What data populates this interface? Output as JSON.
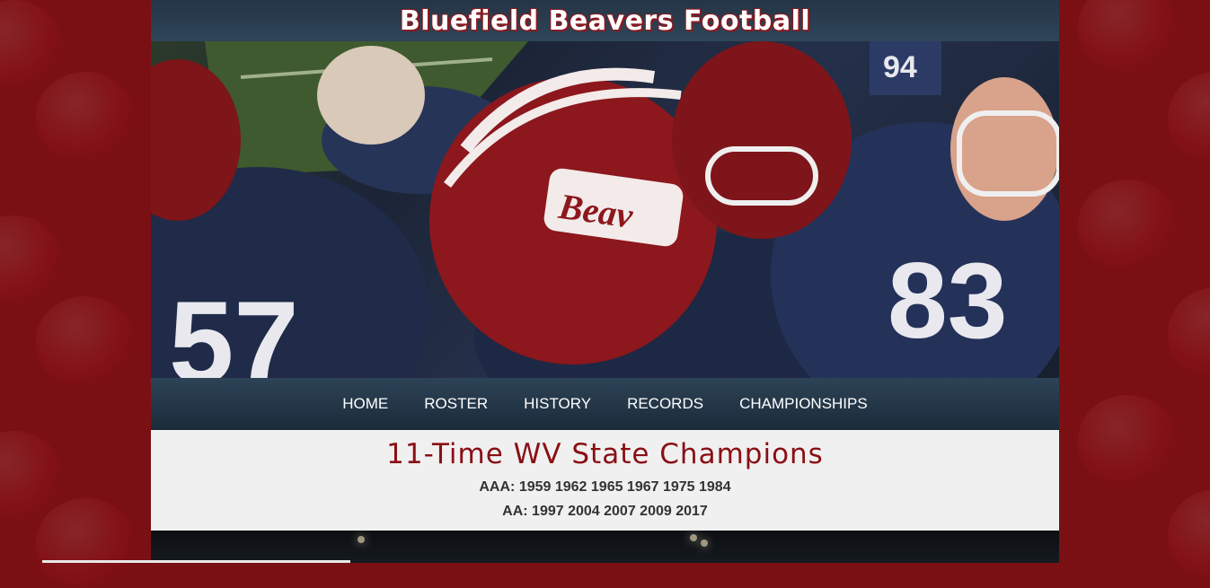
{
  "site": {
    "title": "Bluefield Beavers Football"
  },
  "nav": {
    "items": [
      {
        "label": "HOME"
      },
      {
        "label": "ROSTER"
      },
      {
        "label": "HISTORY"
      },
      {
        "label": "RECORDS"
      },
      {
        "label": "CHAMPIONSHIPS"
      }
    ]
  },
  "championships": {
    "heading": "11-Time WV State Champions",
    "aaa_line": "AAA: 1959 1962 1965 1967 1975 1984",
    "aa_line": "AA: 1997 2004 2007 2009 2017"
  },
  "colors": {
    "brand_red": "#8a0f14",
    "page_background": "#7a1014",
    "header_navy": "#243546"
  }
}
